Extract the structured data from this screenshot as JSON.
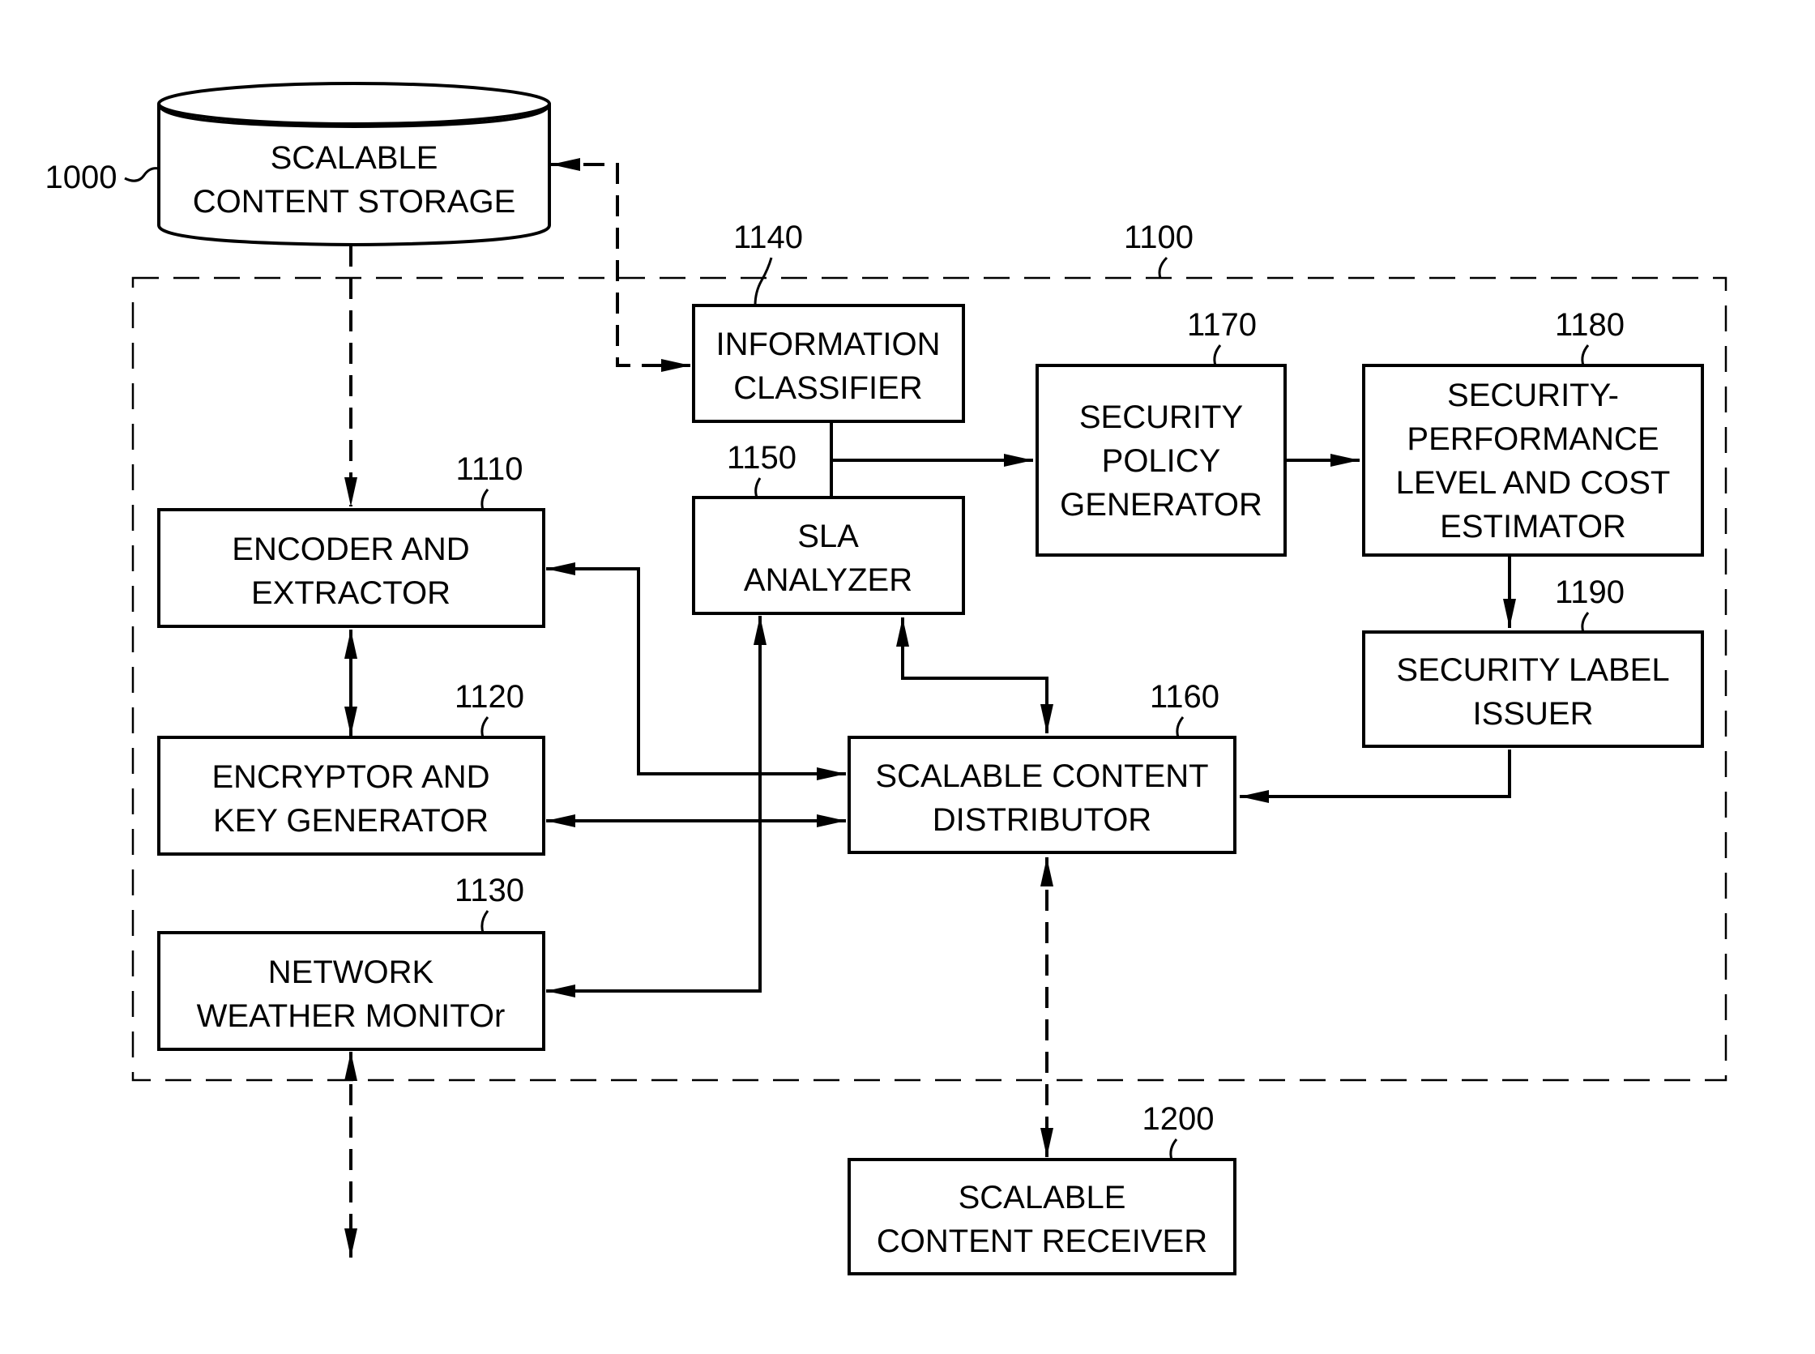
{
  "diagram": {
    "type": "block-diagram",
    "nodes": [
      {
        "id": "1000",
        "ref": "1000",
        "lines": [
          "SCALABLE",
          "CONTENT STORAGE"
        ],
        "shape": "cylinder"
      },
      {
        "id": "1100",
        "ref": "1100",
        "lines": [],
        "shape": "dashed-container"
      },
      {
        "id": "1110",
        "ref": "1110",
        "lines": [
          "ENCODER AND",
          "EXTRACTOR"
        ],
        "shape": "box"
      },
      {
        "id": "1120",
        "ref": "1120",
        "lines": [
          "ENCRYPTOR AND",
          "KEY GENERATOR"
        ],
        "shape": "box"
      },
      {
        "id": "1130",
        "ref": "1130",
        "lines": [
          "NETWORK",
          "WEATHER MONITOr"
        ],
        "shape": "box"
      },
      {
        "id": "1140",
        "ref": "1140",
        "lines": [
          "INFORMATION",
          "CLASSIFIER"
        ],
        "shape": "box"
      },
      {
        "id": "1150",
        "ref": "1150",
        "lines": [
          "SLA",
          "ANALYZER"
        ],
        "shape": "box"
      },
      {
        "id": "1160",
        "ref": "1160",
        "lines": [
          "SCALABLE CONTENT",
          "DISTRIBUTOR"
        ],
        "shape": "box"
      },
      {
        "id": "1170",
        "ref": "1170",
        "lines": [
          "SECURITY",
          "POLICY",
          "GENERATOR"
        ],
        "shape": "box"
      },
      {
        "id": "1180",
        "ref": "1180",
        "lines": [
          "SECURITY-",
          "PERFORMANCE",
          "LEVEL AND COST",
          "ESTIMATOR"
        ],
        "shape": "box"
      },
      {
        "id": "1190",
        "ref": "1190",
        "lines": [
          "SECURITY LABEL",
          "ISSUER"
        ],
        "shape": "box"
      },
      {
        "id": "1200",
        "ref": "1200",
        "lines": [
          "SCALABLE",
          "CONTENT RECEIVER"
        ],
        "shape": "box"
      }
    ],
    "edges": [
      {
        "from": "1000",
        "to": "1110",
        "style": "dashed",
        "direction": "forward"
      },
      {
        "from": "1000",
        "to": "1140",
        "style": "dashed",
        "direction": "both"
      },
      {
        "from": "1110",
        "to": "1120",
        "style": "solid",
        "direction": "both"
      },
      {
        "from": "1110",
        "to": "1160",
        "style": "solid",
        "direction": "both"
      },
      {
        "from": "1120",
        "to": "1160",
        "style": "solid",
        "direction": "both"
      },
      {
        "from": "1130",
        "to": "1150",
        "style": "solid",
        "direction": "both"
      },
      {
        "from": "1140",
        "to": "1170",
        "style": "solid",
        "direction": "forward",
        "via": "1150"
      },
      {
        "from": "1150",
        "to": "1160",
        "style": "solid",
        "direction": "both"
      },
      {
        "from": "1170",
        "to": "1180",
        "style": "solid",
        "direction": "forward"
      },
      {
        "from": "1180",
        "to": "1190",
        "style": "solid",
        "direction": "forward"
      },
      {
        "from": "1190",
        "to": "1160",
        "style": "solid",
        "direction": "forward"
      },
      {
        "from": "1160",
        "to": "1200",
        "style": "dashed",
        "direction": "both"
      },
      {
        "from": "1130",
        "to": "external",
        "style": "dashed",
        "direction": "both"
      }
    ]
  }
}
